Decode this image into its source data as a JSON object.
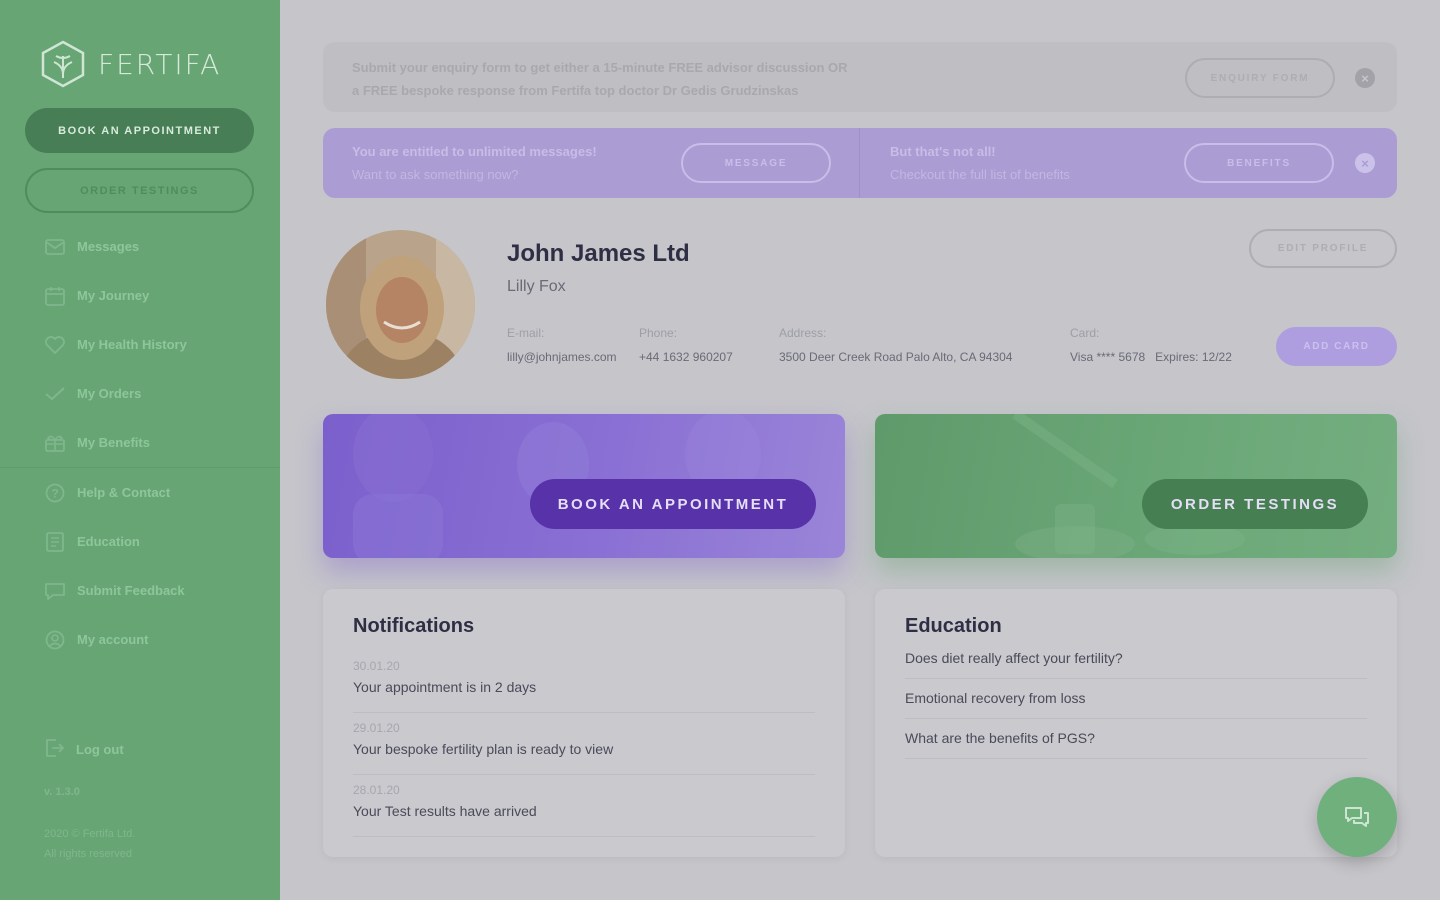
{
  "brand": {
    "name": "FERTIFA"
  },
  "sidebar": {
    "book_label": "BOOK AN APPOINTMENT",
    "order_label": "ORDER TESTINGS",
    "items": [
      {
        "label": "Messages",
        "icon": "mail-icon"
      },
      {
        "label": "My Journey",
        "icon": "calendar-icon"
      },
      {
        "label": "My Health History",
        "icon": "heart-icon"
      },
      {
        "label": "My Orders",
        "icon": "check-icon"
      },
      {
        "label": "My Benefits",
        "icon": "gift-icon"
      },
      {
        "label": "Help & Contact",
        "icon": "help-icon"
      },
      {
        "label": "Education",
        "icon": "book-icon"
      },
      {
        "label": "Submit Feedback",
        "icon": "chat-bubble-icon"
      },
      {
        "label": "My account",
        "icon": "user-circle-icon"
      }
    ],
    "logout_label": "Log out",
    "version": "v. 1.3.0",
    "copyright_line1": "2020 © Fertifa Ltd.",
    "copyright_line2": "All rights reserved"
  },
  "enquiry_banner": {
    "line1": "Submit your enquiry form to get either a 15-minute FREE advisor discussion OR",
    "line2": "a FREE bespoke response from Fertifa top doctor Dr Gedis Grudzinskas",
    "button_label": "ENQUIRY FORM"
  },
  "promo_banner": {
    "left_title": "You are entitled to unlimited messages!",
    "left_sub": "Want to ask something now?",
    "left_button": "MESSAGE",
    "right_title": "But that's not all!",
    "right_sub": "Checkout the full list of benefits",
    "right_button": "BENEFITS"
  },
  "profile": {
    "company": "John James Ltd",
    "person": "Lilly Fox",
    "edit_label": "EDIT PROFILE",
    "email_label": "E-mail:",
    "email": "lilly@johnjames.com",
    "phone_label": "Phone:",
    "phone": "+44 1632 960207",
    "address_label": "Address:",
    "address": "3500 Deer Creek Road Palo Alto, CA 94304",
    "card_label": "Card:",
    "card": "Visa **** 5678   Expires: 12/22",
    "add_card_label": "ADD CARD"
  },
  "hero": {
    "book_label": "BOOK AN APPOINTMENT",
    "order_label": "ORDER TESTINGS"
  },
  "notifications": {
    "title": "Notifications",
    "items": [
      {
        "date": "30.01.20",
        "text": "Your appointment is in 2 days"
      },
      {
        "date": "29.01.20",
        "text": "Your bespoke fertility plan is ready to view"
      },
      {
        "date": "28.01.20",
        "text": "Your Test results have arrived"
      }
    ]
  },
  "education": {
    "title": "Education",
    "items": [
      "Does diet really affect your fertility?",
      "Emotional recovery from loss",
      "What are the benefits of PGS?"
    ]
  },
  "colors": {
    "sidebar_green": "#67a575",
    "brand_purple": "#7b5fcc",
    "overlay_gray": "#c5c5ca"
  }
}
